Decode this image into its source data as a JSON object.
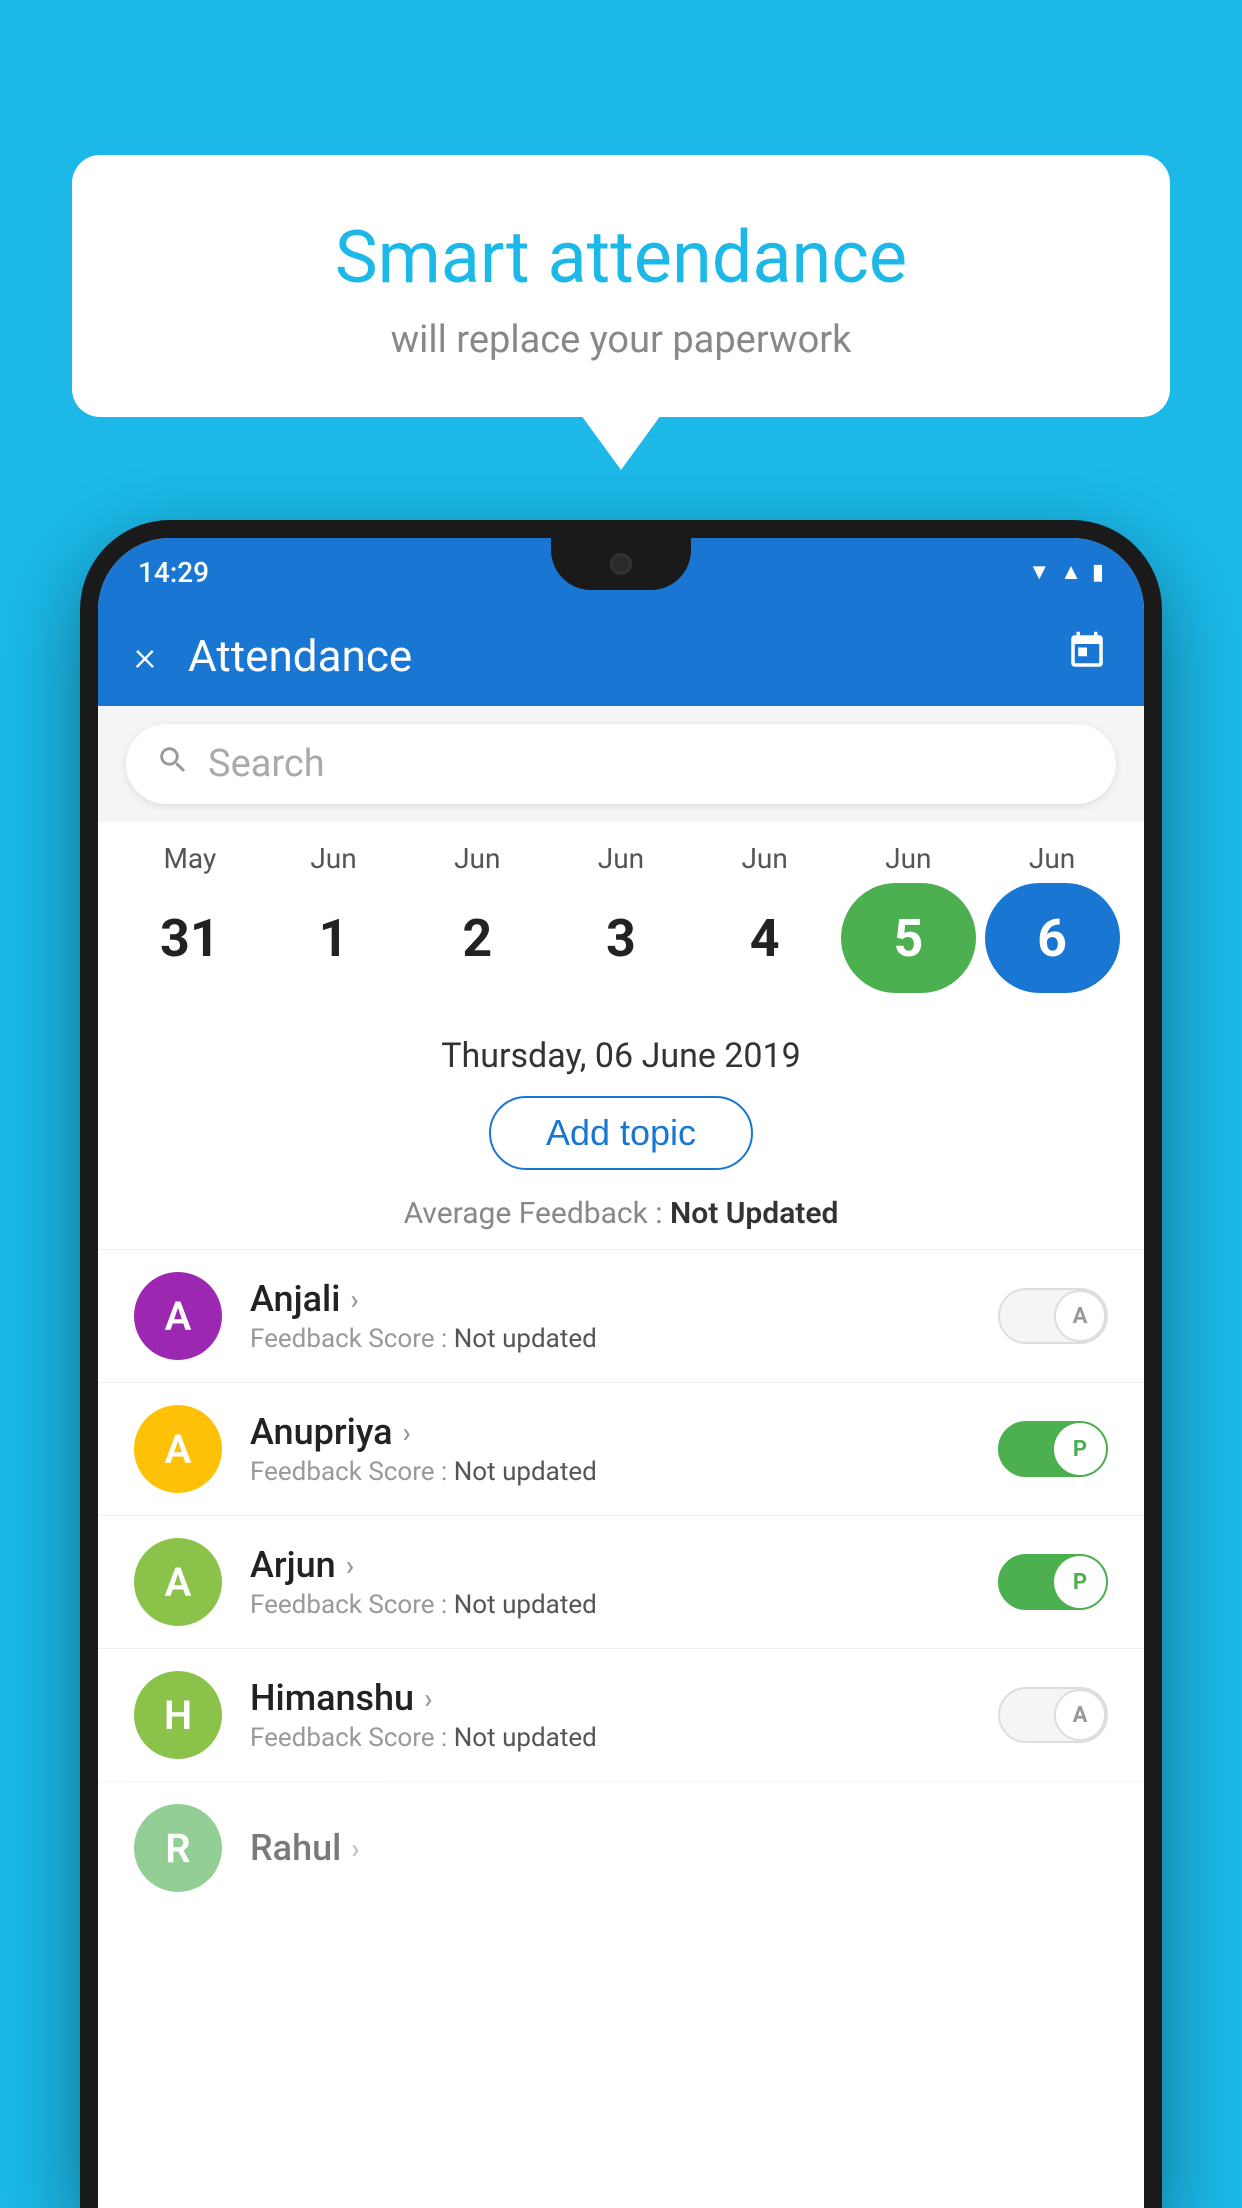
{
  "background_color": "#1BB8E8",
  "bubble": {
    "title": "Smart attendance",
    "subtitle": "will replace your paperwork"
  },
  "status_bar": {
    "time": "14:29",
    "icons": [
      "wifi",
      "signal",
      "battery"
    ]
  },
  "app_bar": {
    "title": "Attendance",
    "close_label": "×",
    "calendar_icon": "📅"
  },
  "search": {
    "placeholder": "Search"
  },
  "calendar": {
    "days": [
      {
        "month": "May",
        "date": "31",
        "state": "normal"
      },
      {
        "month": "Jun",
        "date": "1",
        "state": "normal"
      },
      {
        "month": "Jun",
        "date": "2",
        "state": "normal"
      },
      {
        "month": "Jun",
        "date": "3",
        "state": "normal"
      },
      {
        "month": "Jun",
        "date": "4",
        "state": "normal"
      },
      {
        "month": "Jun",
        "date": "5",
        "state": "today"
      },
      {
        "month": "Jun",
        "date": "6",
        "state": "selected"
      }
    ],
    "selected_date_label": "Thursday, 06 June 2019"
  },
  "add_topic_label": "Add topic",
  "avg_feedback_label": "Average Feedback : ",
  "avg_feedback_value": "Not Updated",
  "students": [
    {
      "name": "Anjali",
      "avatar_letter": "A",
      "avatar_color": "#9C27B0",
      "feedback_label": "Feedback Score : ",
      "feedback_value": "Not updated",
      "toggle_state": "off",
      "toggle_label": "A"
    },
    {
      "name": "Anupriya",
      "avatar_letter": "A",
      "avatar_color": "#FFC107",
      "feedback_label": "Feedback Score : ",
      "feedback_value": "Not updated",
      "toggle_state": "on-p",
      "toggle_label": "P"
    },
    {
      "name": "Arjun",
      "avatar_letter": "A",
      "avatar_color": "#8BC34A",
      "feedback_label": "Feedback Score : ",
      "feedback_value": "Not updated",
      "toggle_state": "on-p",
      "toggle_label": "P"
    },
    {
      "name": "Himanshu",
      "avatar_letter": "H",
      "avatar_color": "#8BC34A",
      "feedback_label": "Feedback Score : ",
      "feedback_value": "Not updated",
      "toggle_state": "off",
      "toggle_label": "A"
    }
  ]
}
